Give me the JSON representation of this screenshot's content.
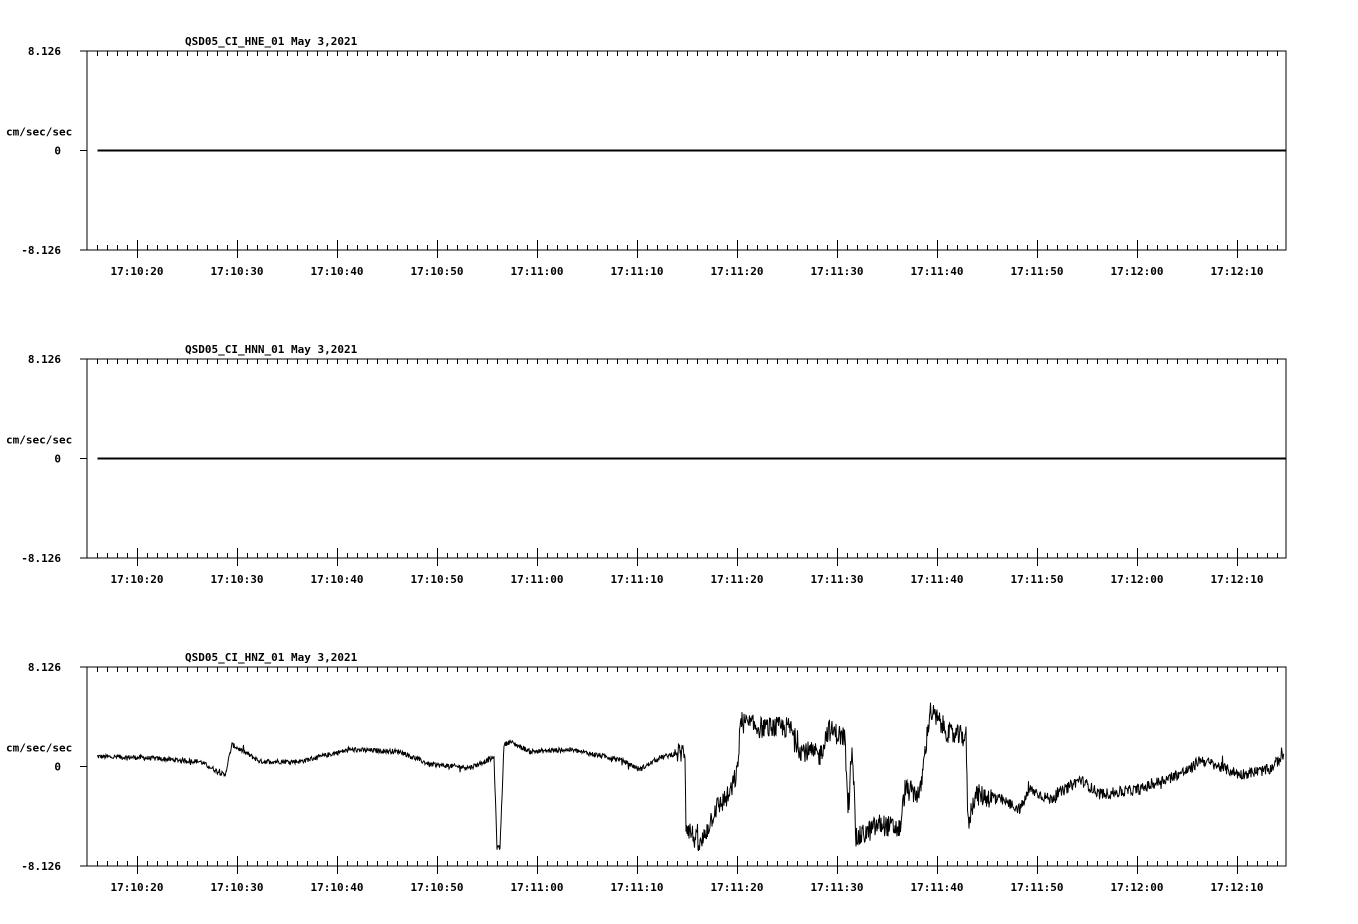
{
  "chart_data": [
    {
      "type": "line",
      "title": "QSD05_CI_HNE_01  May 3,2021",
      "ylabel": "cm/sec/sec",
      "ylim": [
        -8.126,
        8.126
      ],
      "ytick_labels": [
        "8.126",
        "0",
        "-8.126"
      ],
      "xlim_seconds_after_17_10_00": [
        15,
        135
      ],
      "xtick_labels": [
        "17:10:20",
        "17:10:30",
        "17:10:40",
        "17:10:50",
        "17:11:00",
        "17:11:10",
        "17:11:20",
        "17:11:30",
        "17:11:40",
        "17:11:50",
        "17:12:00",
        "17:12:10"
      ],
      "series": [
        {
          "name": "HNE",
          "t": [
            16,
            135
          ],
          "values": [
            0,
            0
          ],
          "noise": 0
        }
      ]
    },
    {
      "type": "line",
      "title": "QSD05_CI_HNN_01  May 3,2021",
      "ylabel": "cm/sec/sec",
      "ylim": [
        -8.126,
        8.126
      ],
      "ytick_labels": [
        "8.126",
        "0",
        "-8.126"
      ],
      "xlim_seconds_after_17_10_00": [
        15,
        135
      ],
      "xtick_labels": [
        "17:10:20",
        "17:10:30",
        "17:10:40",
        "17:10:50",
        "17:11:00",
        "17:11:10",
        "17:11:20",
        "17:11:30",
        "17:11:40",
        "17:11:50",
        "17:12:00",
        "17:12:10"
      ],
      "series": [
        {
          "name": "HNN",
          "t": [
            16,
            135
          ],
          "values": [
            0,
            0
          ],
          "noise": 0
        }
      ]
    },
    {
      "type": "line",
      "title": "QSD05_CI_HNZ_01  May 3,2021",
      "ylabel": "cm/sec/sec",
      "ylim": [
        -8.126,
        8.126
      ],
      "ytick_labels": [
        "8.126",
        "0",
        "-8.126"
      ],
      "xlim_seconds_after_17_10_00": [
        15,
        135
      ],
      "xtick_labels": [
        "17:10:20",
        "17:10:30",
        "17:10:40",
        "17:10:50",
        "17:11:00",
        "17:11:10",
        "17:11:20",
        "17:11:30",
        "17:11:40",
        "17:11:50",
        "17:12:00",
        "17:12:10"
      ],
      "series": [
        {
          "name": "HNZ",
          "t": [
            16,
            20.3,
            26.3,
            28.8,
            29.5,
            32.3,
            36.3,
            41.3,
            46.3,
            49.3,
            53.3,
            55.7,
            56.0,
            56.3,
            56.7,
            57.3,
            59.3,
            63.3,
            68.3,
            70.3,
            72.3,
            74.8,
            74.9,
            76.3,
            77.8,
            79.3,
            80.1,
            80.3,
            82.3,
            85.3,
            86.3,
            88.3,
            89.1,
            90.8,
            91.1,
            91.5,
            91.9,
            94.3,
            96.3,
            96.8,
            98.3,
            99.3,
            101.3,
            102.9,
            103.1,
            103.8,
            106.3,
            108.3,
            109.3,
            111.3,
            114.3,
            116.3,
            120.3,
            125.3,
            126.3,
            130.3,
            133.3,
            134.7
          ],
          "values": [
            0.81,
            0.73,
            0.41,
            -0.73,
            1.79,
            0.41,
            0.41,
            1.38,
            1.22,
            0.16,
            -0.08,
            0.73,
            -6.6,
            -6.6,
            1.79,
            2.03,
            1.22,
            1.38,
            0.57,
            -0.24,
            0.73,
            1.22,
            -4.71,
            -6.6,
            -3.49,
            -2.28,
            -0.24,
            3.66,
            3.17,
            3.17,
            1.38,
            0.89,
            3.01,
            2.36,
            -4.3,
            2.11,
            -5.93,
            -4.71,
            -5.12,
            -1.87,
            -2.28,
            4.55,
            2.6,
            2.44,
            -4.71,
            -2.28,
            -2.68,
            -3.49,
            -1.87,
            -2.68,
            -1.06,
            -2.28,
            -1.87,
            -0.24,
            0.57,
            -0.65,
            -0.24,
            1.0
          ],
          "noise": 1
        }
      ]
    }
  ]
}
